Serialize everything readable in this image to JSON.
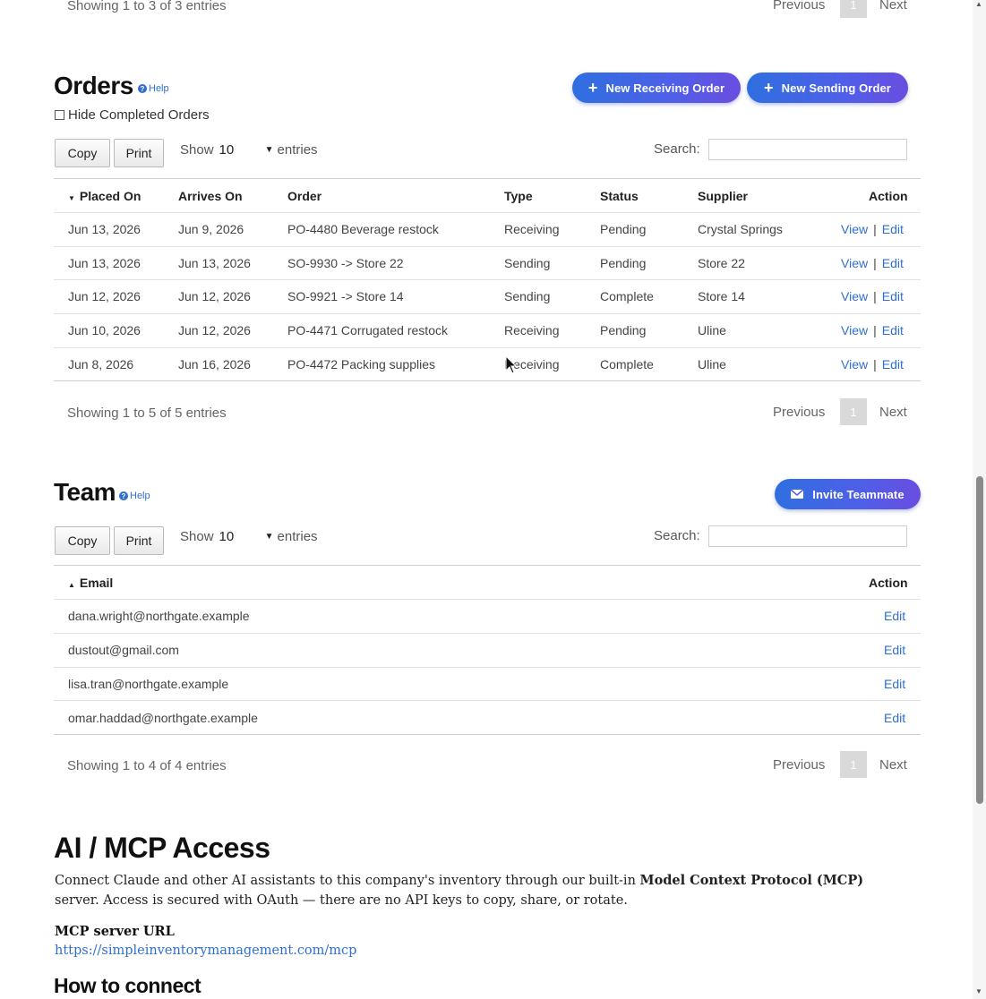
{
  "top_pagination": {
    "info": "Showing 1 to 3 of 3 entries",
    "previous": "Previous",
    "page": "1",
    "next": "Next"
  },
  "orders": {
    "title": "Orders",
    "help": "Help",
    "hide_completed_label": "Hide Completed Orders",
    "new_receiving_label": "New Receiving Order",
    "new_sending_label": "New Sending Order",
    "copy": "Copy",
    "print": "Print",
    "show_label": "Show",
    "show_value": "10",
    "entries_label": "entries",
    "search_label": "Search:",
    "columns": [
      "Placed On",
      "Arrives On",
      "Order",
      "Type",
      "Status",
      "Supplier",
      "Action"
    ],
    "rows": [
      {
        "placed": "Jun 13, 2026",
        "arrives": "Jun 9, 2026",
        "order": "PO-4480 Beverage restock",
        "type": "Receiving",
        "status": "Pending",
        "supplier": "Crystal Springs"
      },
      {
        "placed": "Jun 13, 2026",
        "arrives": "Jun 13, 2026",
        "order": "SO-9930 -> Store 22",
        "type": "Sending",
        "status": "Pending",
        "supplier": "Store 22"
      },
      {
        "placed": "Jun 12, 2026",
        "arrives": "Jun 12, 2026",
        "order": "SO-9921 -> Store 14",
        "type": "Sending",
        "status": "Complete",
        "supplier": "Store 14"
      },
      {
        "placed": "Jun 10, 2026",
        "arrives": "Jun 12, 2026",
        "order": "PO-4471 Corrugated restock",
        "type": "Receiving",
        "status": "Pending",
        "supplier": "Uline"
      },
      {
        "placed": "Jun 8, 2026",
        "arrives": "Jun 16, 2026",
        "order": "PO-4472 Packing supplies",
        "type": "Receiving",
        "status": "Complete",
        "supplier": "Uline"
      }
    ],
    "view": "View",
    "sep": "|",
    "edit": "Edit",
    "info": "Showing 1 to 5 of 5 entries",
    "previous": "Previous",
    "page": "1",
    "next": "Next"
  },
  "team": {
    "title": "Team",
    "help": "Help",
    "invite_label": "Invite Teammate",
    "copy": "Copy",
    "print": "Print",
    "show_label": "Show",
    "show_value": "10",
    "entries_label": "entries",
    "search_label": "Search:",
    "columns": [
      "Email",
      "Action"
    ],
    "rows": [
      "dana.wright@northgate.example",
      "dustout@gmail.com",
      "lisa.tran@northgate.example",
      "omar.haddad@northgate.example"
    ],
    "edit": "Edit",
    "info": "Showing 1 to 4 of 4 entries",
    "previous": "Previous",
    "page": "1",
    "next": "Next"
  },
  "mcp": {
    "title": "AI / MCP Access",
    "desc_part1": "Connect Claude and other AI assistants to this company's inventory through our built-in ",
    "desc_bold": "Model Context Protocol (MCP)",
    "desc_part2": " server. Access is secured with OAuth — there are no API keys to copy, share, or rotate.",
    "server_url_label": "MCP server URL",
    "server_url": "https://simpleinventorymanagement.com/mcp",
    "how_to_connect": "How to connect"
  },
  "colors": {
    "accent": "#2f6fd0",
    "button_gradient_start": "#2f6fe0",
    "button_gradient_end": "#6a4de0"
  }
}
